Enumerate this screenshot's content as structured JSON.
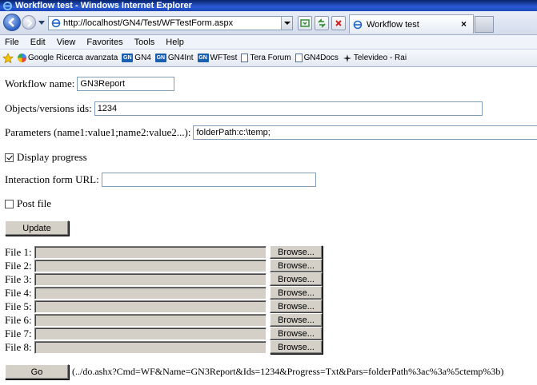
{
  "window": {
    "title": "Workflow test - Windows Internet Explorer"
  },
  "nav": {
    "address": "http://localhost/GN4/Test/WFTestForm.aspx",
    "tab_title": "Workflow test",
    "tab_close": "×"
  },
  "menu": {
    "items": [
      "File",
      "Edit",
      "View",
      "Favorites",
      "Tools",
      "Help"
    ]
  },
  "links": {
    "items": [
      {
        "label": "Google Ricerca avanzata",
        "icon": "google-icon"
      },
      {
        "label": "GN4",
        "icon": "gn-icon"
      },
      {
        "label": "GN4Int",
        "icon": "gn-icon"
      },
      {
        "label": "WFTest",
        "icon": "gn-icon"
      },
      {
        "label": "Tera Forum",
        "icon": "page-icon"
      },
      {
        "label": "GN4Docs",
        "icon": "page-icon"
      },
      {
        "label": "Televideo - Rai",
        "icon": "televideo-icon"
      }
    ]
  },
  "form": {
    "workflow_name_label": "Workflow name:",
    "workflow_name_value": "GN3Report",
    "ids_label": "Objects/versions ids:",
    "ids_value": "1234",
    "params_label": "Parameters (name1:value1;name2:value2...):",
    "params_value": "folderPath:c:\\temp;",
    "display_progress_label": "Display progress",
    "display_progress_checked": true,
    "interaction_url_label": "Interaction form URL:",
    "interaction_url_value": "",
    "post_file_label": "Post file",
    "post_file_checked": false,
    "update_label": "Update",
    "files": [
      {
        "label": "File 1:",
        "browse": "Browse..."
      },
      {
        "label": "File 2:",
        "browse": "Browse..."
      },
      {
        "label": "File 3:",
        "browse": "Browse..."
      },
      {
        "label": "File 4:",
        "browse": "Browse..."
      },
      {
        "label": "File 5:",
        "browse": "Browse..."
      },
      {
        "label": "File 6:",
        "browse": "Browse..."
      },
      {
        "label": "File 7:",
        "browse": "Browse..."
      },
      {
        "label": "File 8:",
        "browse": "Browse..."
      }
    ],
    "go_label": "Go",
    "result_url": "(../do.ashx?Cmd=WF&Name=GN3Report&Ids=1234&Progress=Txt&Pars=folderPath%3ac%3a%5ctemp%3b)"
  }
}
